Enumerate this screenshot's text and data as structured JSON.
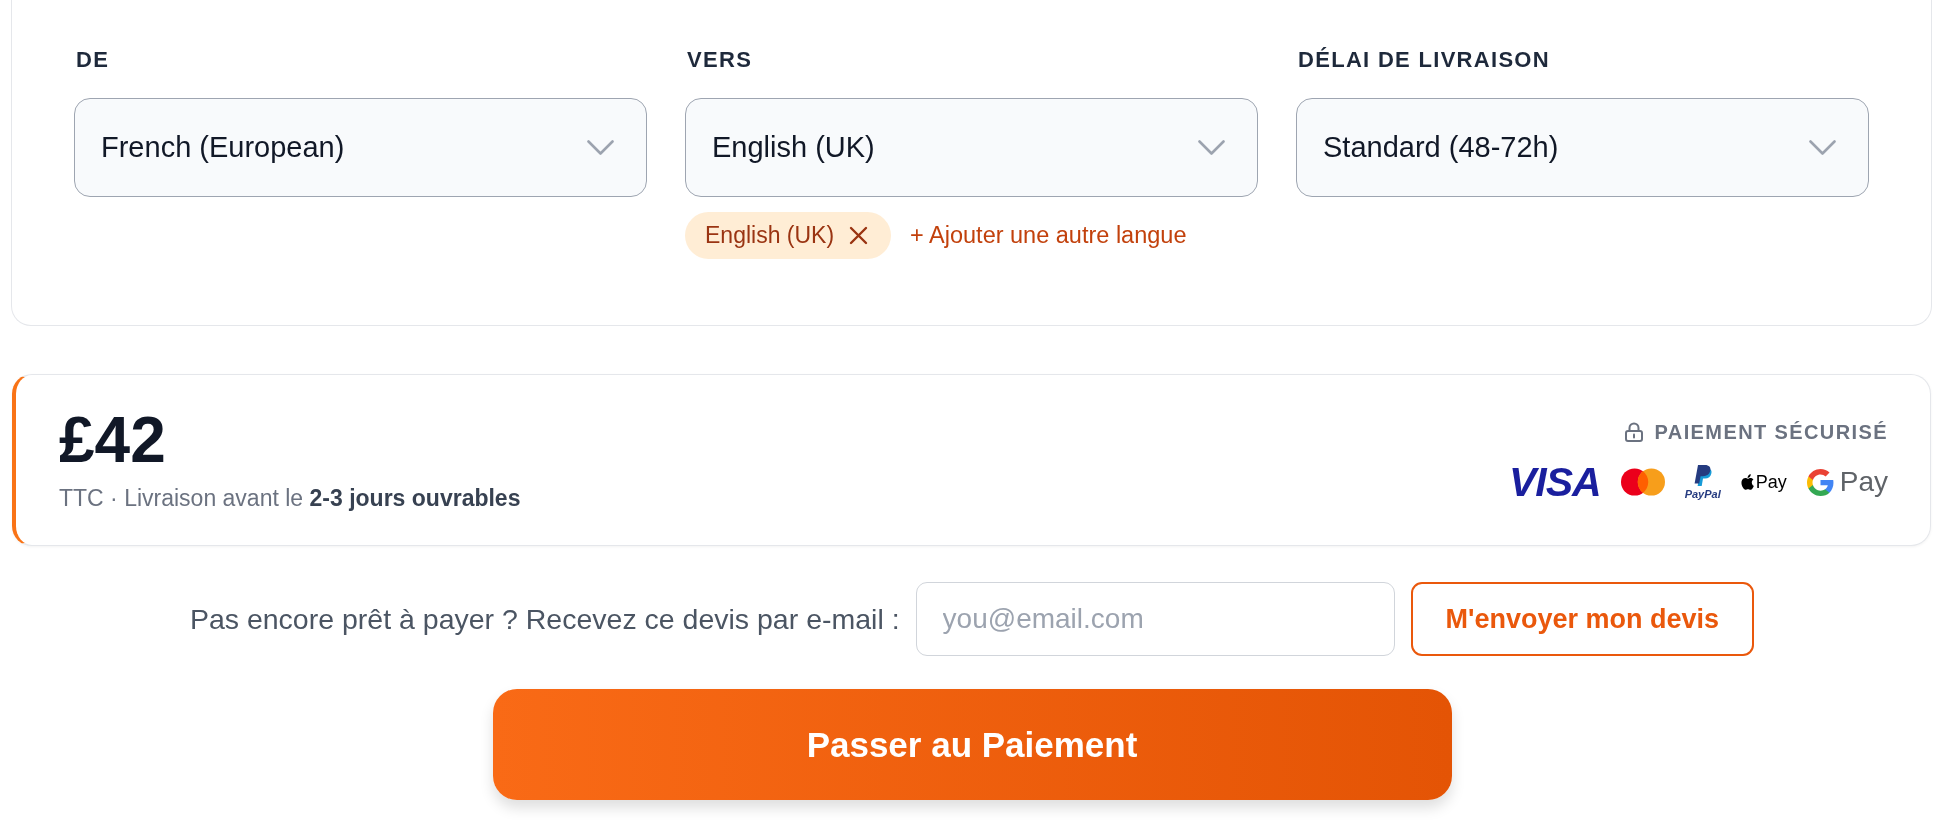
{
  "fields": [
    {
      "label": "DE",
      "value": "French (European)"
    },
    {
      "label": "VERS",
      "value": "English (UK)",
      "tags": [
        {
          "label": "English (UK)"
        }
      ],
      "add_link": "+ Ajouter une autre langue"
    },
    {
      "label": "DÉLAI DE LIVRAISON",
      "value": "Standard (48-72h)"
    }
  ],
  "price_card": {
    "amount": "£42",
    "note": "TTC · Livraison avant le **2-3 jours ouvrables**",
    "secure_label": "PAIEMENT SÉCURISÉ",
    "payment_methods": [
      {
        "kind": "visa",
        "label": "VISA"
      },
      {
        "kind": "mastercard"
      },
      {
        "kind": "paypal",
        "label": "PayPal"
      },
      {
        "kind": "applepay",
        "label": "Pay"
      },
      {
        "kind": "googlepay",
        "label": "Pay"
      }
    ]
  },
  "email_quote": {
    "prompt": "Pas encore prêt à payer ? Recevez ce devis par e-mail :",
    "placeholder": "you@email.com",
    "button": "M'envoyer mon devis"
  },
  "checkout_button": "Passer au Paiement"
}
